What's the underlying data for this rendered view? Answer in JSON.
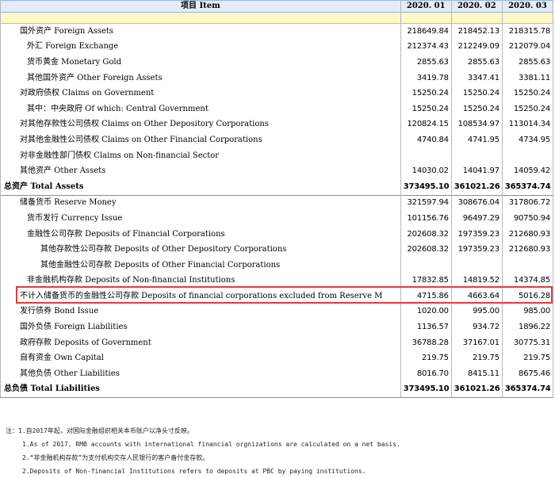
{
  "table": {
    "header": {
      "item": "项目 Item",
      "cols": [
        "2020. 01",
        "2020. 02",
        "2020. 03"
      ]
    },
    "rows": [
      {
        "label": "国外资产  Foreign Assets",
        "indent": 1,
        "bold": false,
        "sep": false,
        "values": [
          "218649.84",
          "218452.13",
          "218315.78"
        ]
      },
      {
        "label": "外汇  Foreign Exchange",
        "indent": 2,
        "bold": false,
        "sep": false,
        "values": [
          "212374.43",
          "212249.09",
          "212079.04"
        ]
      },
      {
        "label": "货币黄金  Monetary Gold",
        "indent": 2,
        "bold": false,
        "sep": false,
        "values": [
          "2855.63",
          "2855.63",
          "2855.63"
        ]
      },
      {
        "label": "其他国外资产  Other Foreign Assets",
        "indent": 2,
        "bold": false,
        "sep": false,
        "values": [
          "3419.78",
          "3347.41",
          "3381.11"
        ]
      },
      {
        "label": "对政府债权  Claims on Government",
        "indent": 1,
        "bold": false,
        "sep": false,
        "values": [
          "15250.24",
          "15250.24",
          "15250.24"
        ]
      },
      {
        "label": "其中：中央政府  Of which: Central Government",
        "indent": 2,
        "bold": false,
        "sep": false,
        "values": [
          "15250.24",
          "15250.24",
          "15250.24"
        ]
      },
      {
        "label": "对其他存款性公司债权  Claims on Other Depository Corporations",
        "indent": 1,
        "bold": false,
        "sep": false,
        "values": [
          "120824.15",
          "108534.97",
          "113014.34"
        ]
      },
      {
        "label": "对其他金融性公司债权  Claims on Other Financial Corporations",
        "indent": 1,
        "bold": false,
        "sep": false,
        "values": [
          "4740.84",
          "4741.95",
          "4734.95"
        ]
      },
      {
        "label": "对非金融性部门债权  Claims on Non-financial Sector",
        "indent": 1,
        "bold": false,
        "sep": false,
        "values": [
          "",
          "",
          ""
        ]
      },
      {
        "label": "其他资产  Other Assets",
        "indent": 1,
        "bold": false,
        "sep": false,
        "values": [
          "14030.02",
          "14041.97",
          "14059.42"
        ]
      },
      {
        "label": "总资产  Total Assets",
        "indent": 0,
        "bold": true,
        "sep": false,
        "values": [
          "373495.10",
          "361021.26",
          "365374.74"
        ]
      },
      {
        "label": "储备货币  Reserve Money",
        "indent": 1,
        "bold": false,
        "sep": true,
        "values": [
          "321597.94",
          "308676.04",
          "317806.72"
        ]
      },
      {
        "label": "货币发行  Currency Issue",
        "indent": 2,
        "bold": false,
        "sep": false,
        "values": [
          "101156.76",
          "96497.29",
          "90750.94"
        ]
      },
      {
        "label": "金融性公司存款  Deposits of Financial Corporations",
        "indent": 2,
        "bold": false,
        "sep": false,
        "values": [
          "202608.32",
          "197359.23",
          "212680.93"
        ]
      },
      {
        "label": "其他存款性公司存款  Deposits of Other Depository Corporations",
        "indent": 3,
        "bold": false,
        "sep": false,
        "values": [
          "202608.32",
          "197359.23",
          "212680.93"
        ]
      },
      {
        "label": "其他金融性公司存款  Deposits of Other Financial Corporations",
        "indent": 3,
        "bold": false,
        "sep": false,
        "values": [
          "",
          "",
          ""
        ]
      },
      {
        "label": "非金融机构存款  Deposits of Non-financial Institutions",
        "indent": 2,
        "bold": false,
        "sep": false,
        "values": [
          "17832.85",
          "14819.52",
          "14374.85"
        ]
      },
      {
        "label": "不计入储备货币的金融性公司存款  Deposits of financial corporations excluded from Reserve M",
        "indent": 1,
        "bold": false,
        "sep": false,
        "values": [
          "4715.86",
          "4663.64",
          "5016.28"
        ]
      },
      {
        "label": "发行债券  Bond Issue",
        "indent": 1,
        "bold": false,
        "sep": false,
        "values": [
          "1020.00",
          "995.00",
          "985.00"
        ]
      },
      {
        "label": "国外负债  Foreign Liabilities",
        "indent": 1,
        "bold": false,
        "sep": false,
        "values": [
          "1136.57",
          "934.72",
          "1896.22"
        ]
      },
      {
        "label": "政府存款  Deposits of Government",
        "indent": 1,
        "bold": false,
        "sep": false,
        "values": [
          "36788.28",
          "37167.01",
          "30775.31"
        ]
      },
      {
        "label": "自有资金  Own Capital",
        "indent": 1,
        "bold": false,
        "sep": false,
        "values": [
          "219.75",
          "219.75",
          "219.75"
        ]
      },
      {
        "label": "其他负债  Other Liabilities",
        "indent": 1,
        "bold": false,
        "sep": false,
        "values": [
          "8016.70",
          "8415.11",
          "8675.46"
        ]
      },
      {
        "label": "总负债  Total Liabilities",
        "indent": 0,
        "bold": true,
        "sep": false,
        "values": [
          "373495.10",
          "361021.26",
          "365374.74"
        ]
      }
    ]
  },
  "highlight_color": "#e03c3c",
  "notes": [
    "注：1.自2017年起，对国际金融组织相关本币账户以净头寸反映。",
    "1.As of 2017, RMB accounts with international financial orgnizations are calculated on a net basis.",
    "2.“非金融机构存款”为支付机构交存人民银行的客户备付金存款。",
    "2.Deposits of Non-financial Institutions refers to deposits at PBC by paying institutions."
  ]
}
